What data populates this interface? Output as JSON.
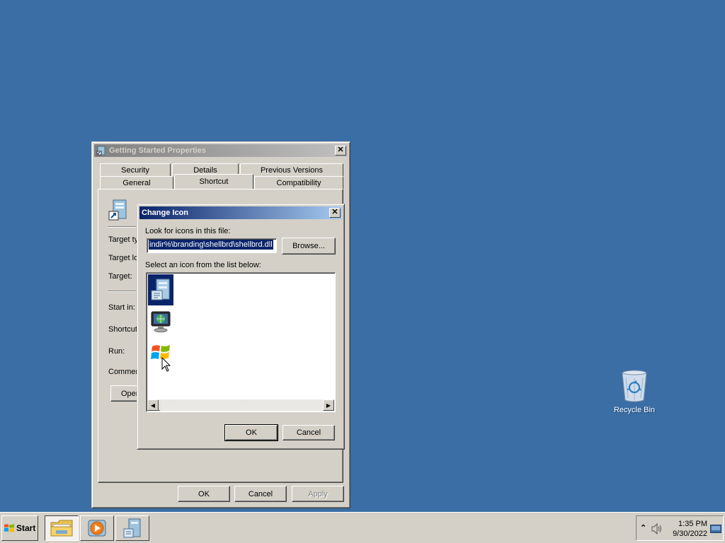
{
  "desktop": {
    "recycle_bin_label": "Recycle Bin"
  },
  "properties_window": {
    "title": "Getting Started Properties",
    "tabs_row1": [
      "Security",
      "Details",
      "Previous Versions"
    ],
    "tabs_row2": [
      "General",
      "Shortcut",
      "Compatibility"
    ],
    "selected_tab": "Shortcut",
    "labels": {
      "target_type": "Target ty",
      "target_location": "Target lo",
      "target": "Target:",
      "start_in": "Start in:",
      "shortcut_key": "Shortcut",
      "run": "Run:",
      "comment": "Commen",
      "open_button": "Oper"
    },
    "buttons": {
      "ok": "OK",
      "cancel": "Cancel",
      "apply": "Apply"
    }
  },
  "change_icon_dialog": {
    "title": "Change Icon",
    "look_for_label": "Look for icons in this file:",
    "file_path": "indir%\\branding\\shellbrd\\shellbrd.dll",
    "browse_button": "Browse...",
    "select_label": "Select an icon from the list below:",
    "icons": [
      "getting-started-icon",
      "computer-globe-icon",
      "windows-flag-icon"
    ],
    "ok_button": "OK",
    "cancel_button": "Cancel"
  },
  "taskbar": {
    "start_label": "Start",
    "clock_time": "1:35 PM",
    "clock_date": "9/30/2022"
  }
}
